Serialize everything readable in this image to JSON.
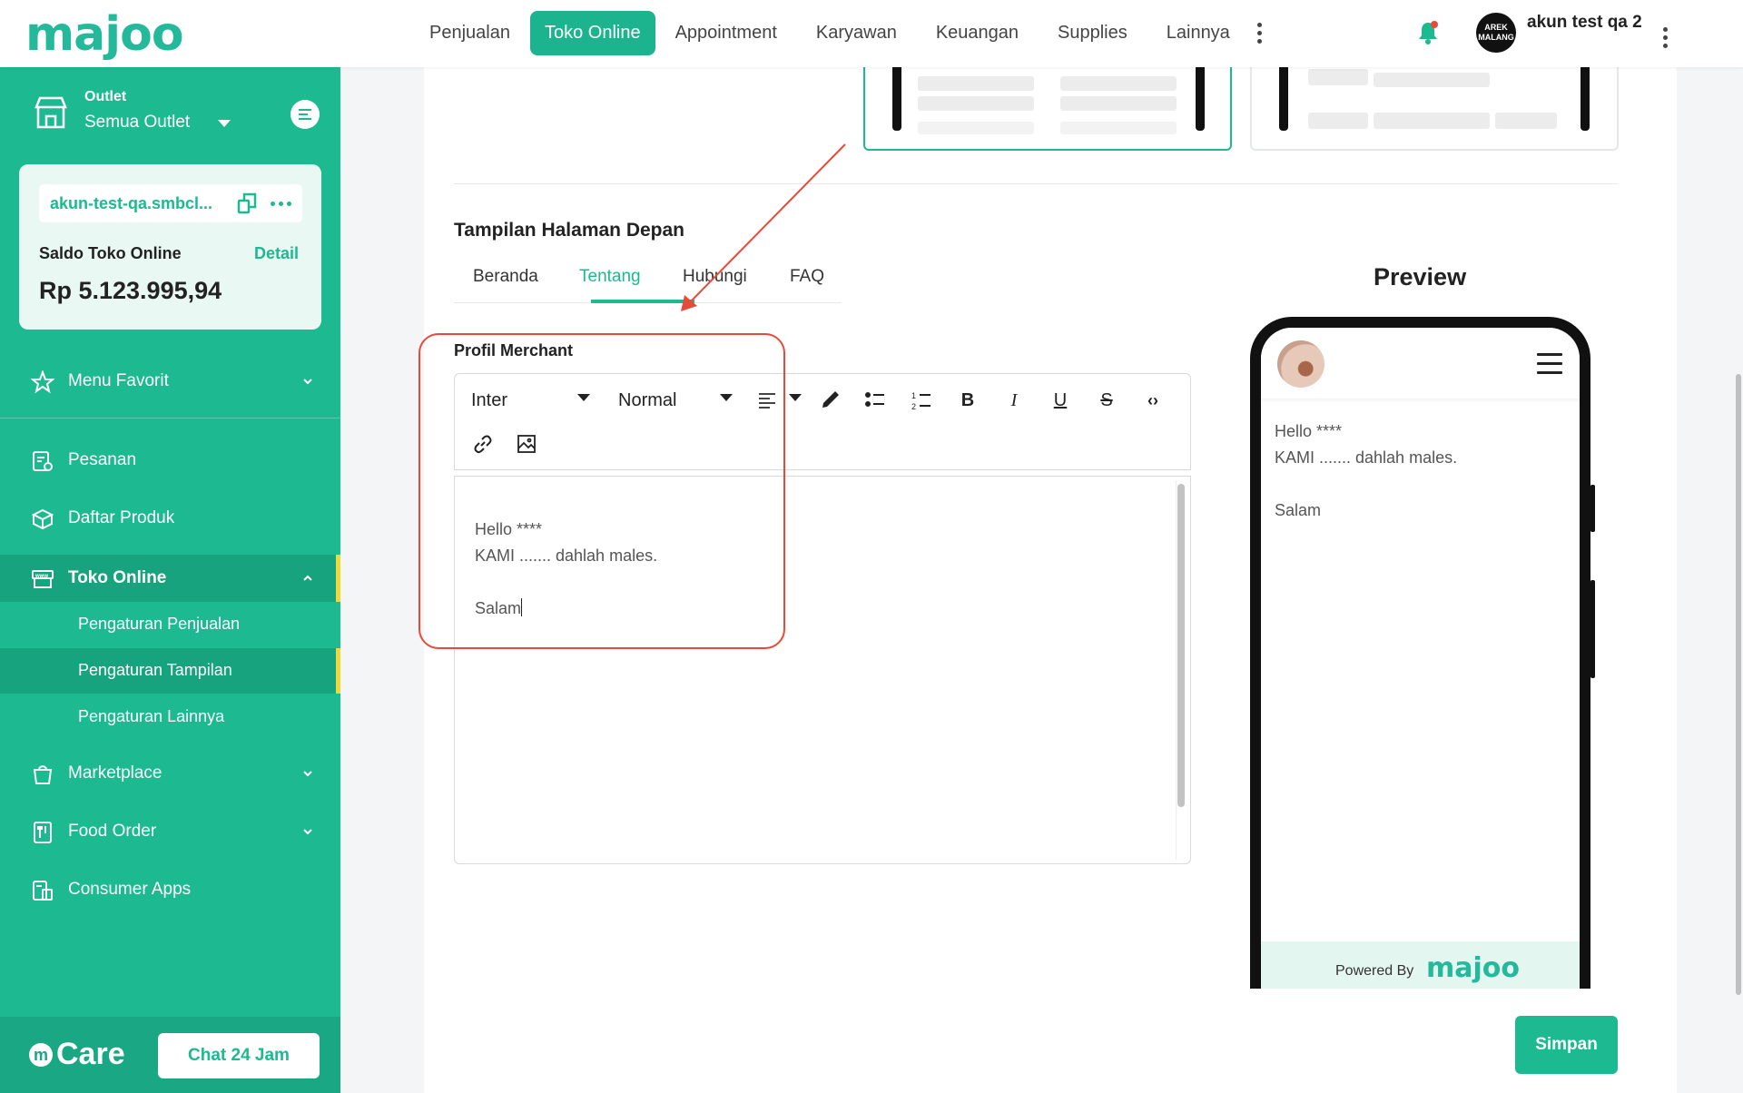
{
  "brand": {
    "logo_text": "majoo",
    "accent_color": "#1db990"
  },
  "topnav": {
    "items": [
      "Penjualan",
      "Toko Online",
      "Appointment",
      "Karyawan",
      "Keuangan",
      "Supplies",
      "Lainnya"
    ],
    "active": "Toko Online"
  },
  "user": {
    "avatar_text": "AREK MALANG",
    "name": "akun test qa 2"
  },
  "sidebar": {
    "outlet_label": "Outlet",
    "outlet_value": "Semua Outlet",
    "store_url": "akun-test-qa.smbcl...",
    "saldo_label": "Saldo Toko Online",
    "saldo_detail": "Detail",
    "saldo_amount": "Rp 5.123.995,94",
    "menu_favorit": "Menu Favorit",
    "items": {
      "pesanan": "Pesanan",
      "daftar_produk": "Daftar Produk",
      "toko_online": "Toko Online",
      "pengaturan_penjualan": "Pengaturan Penjualan",
      "pengaturan_tampilan": "Pengaturan Tampilan",
      "pengaturan_lainnya": "Pengaturan Lainnya",
      "marketplace": "Marketplace",
      "food_order": "Food Order",
      "consumer_apps": "Consumer Apps"
    },
    "care_label": "Care",
    "chat_button": "Chat 24 Jam"
  },
  "main": {
    "section_title": "Tampilan Halaman Depan",
    "tabs": [
      "Beranda",
      "Tentang",
      "Hubungi",
      "FAQ"
    ],
    "active_tab": "Tentang",
    "field_label": "Profil Merchant",
    "toolbar": {
      "font": "Inter",
      "size": "Normal"
    },
    "editor_lines": [
      "Hello ****",
      "KAMI ....... dahlah males.",
      "",
      "Salam"
    ],
    "preview_title": "Preview",
    "preview_footer": "Powered By",
    "preview_logo": "majoo",
    "save_button": "Simpan"
  }
}
